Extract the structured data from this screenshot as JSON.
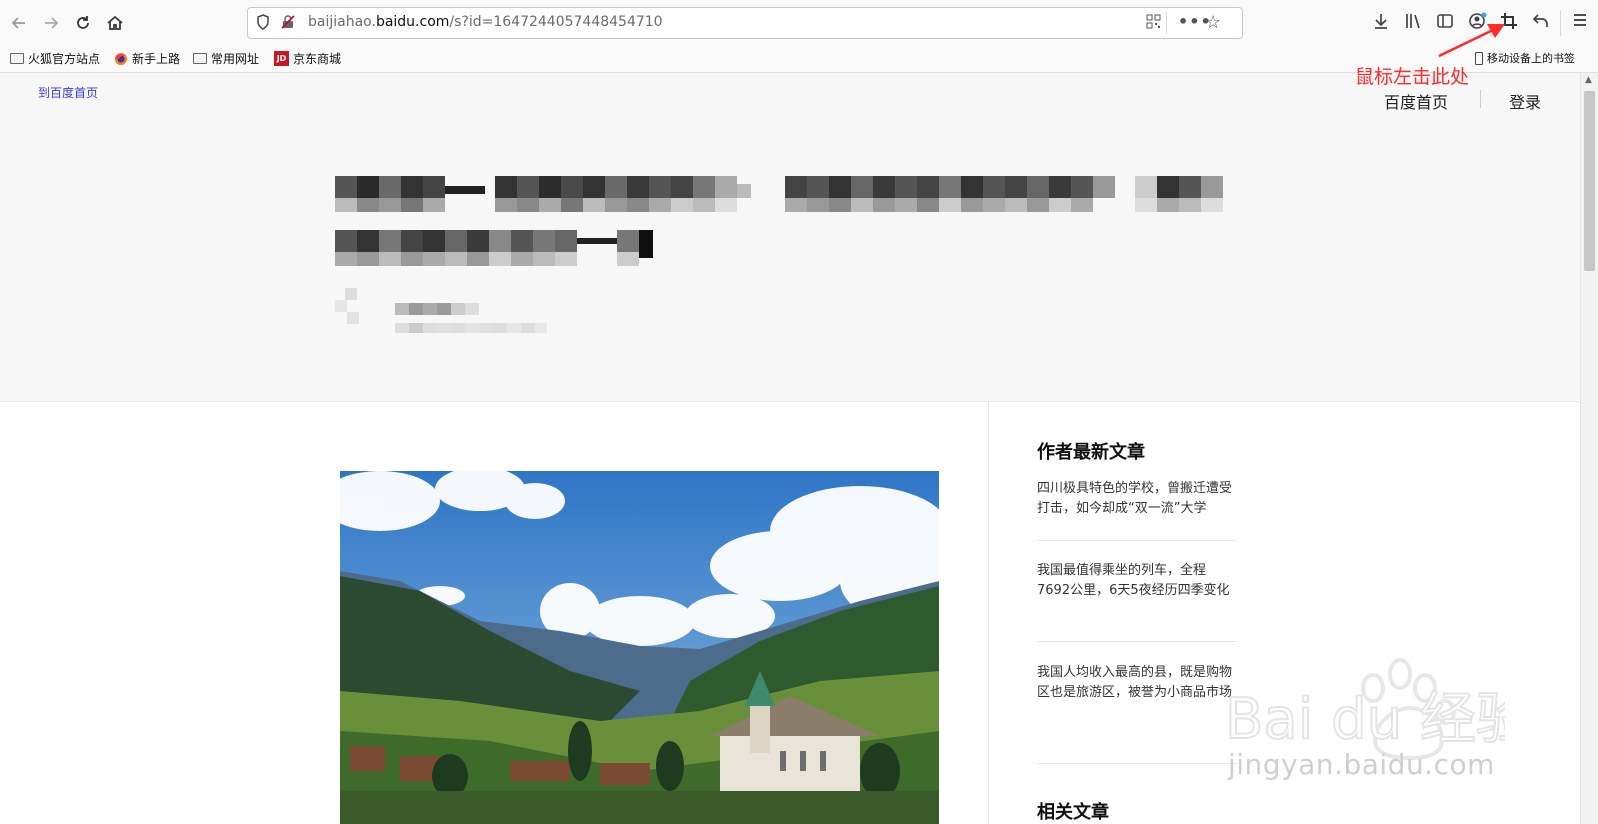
{
  "browser": {
    "url_prefix": "baijiahao.",
    "url_domain": "baidu.com",
    "url_path": "/s?id=1647244057448454710",
    "bookmarks": [
      {
        "label": "火狐官方站点",
        "icon": "folder-icon"
      },
      {
        "label": "新手上路",
        "icon": "firefox-icon"
      },
      {
        "label": "常用网址",
        "icon": "folder-icon"
      },
      {
        "label": "京东商城",
        "icon": "jd-icon"
      }
    ],
    "mobile_bookmarks": "移动设备上的书签",
    "jd_badge": "JD"
  },
  "annotation": {
    "text": "鼠标左击此处",
    "color": "#ff2a2a"
  },
  "page_header": {
    "back_home_link": "到百度首页",
    "home_link": "百度首页",
    "login_link": "登录"
  },
  "sidebar": {
    "title": "作者最新文章",
    "articles": [
      "四川极具特色的学校，曾搬迁遭受打击，如今却成“双一流”大学",
      "我国最值得乘坐的列车，全程7692公里，6天5夜经历四季变化",
      "我国人均收入最高的县，既是购物区也是旅游区，被誉为小商品市场"
    ],
    "related_title": "相关文章"
  },
  "watermark": {
    "brand": "Bai du 经验",
    "url": "jingyan.baidu.com"
  },
  "colors": {
    "link_blue": "#3a3ad8",
    "toolbar_bg": "#f9f9fa"
  }
}
